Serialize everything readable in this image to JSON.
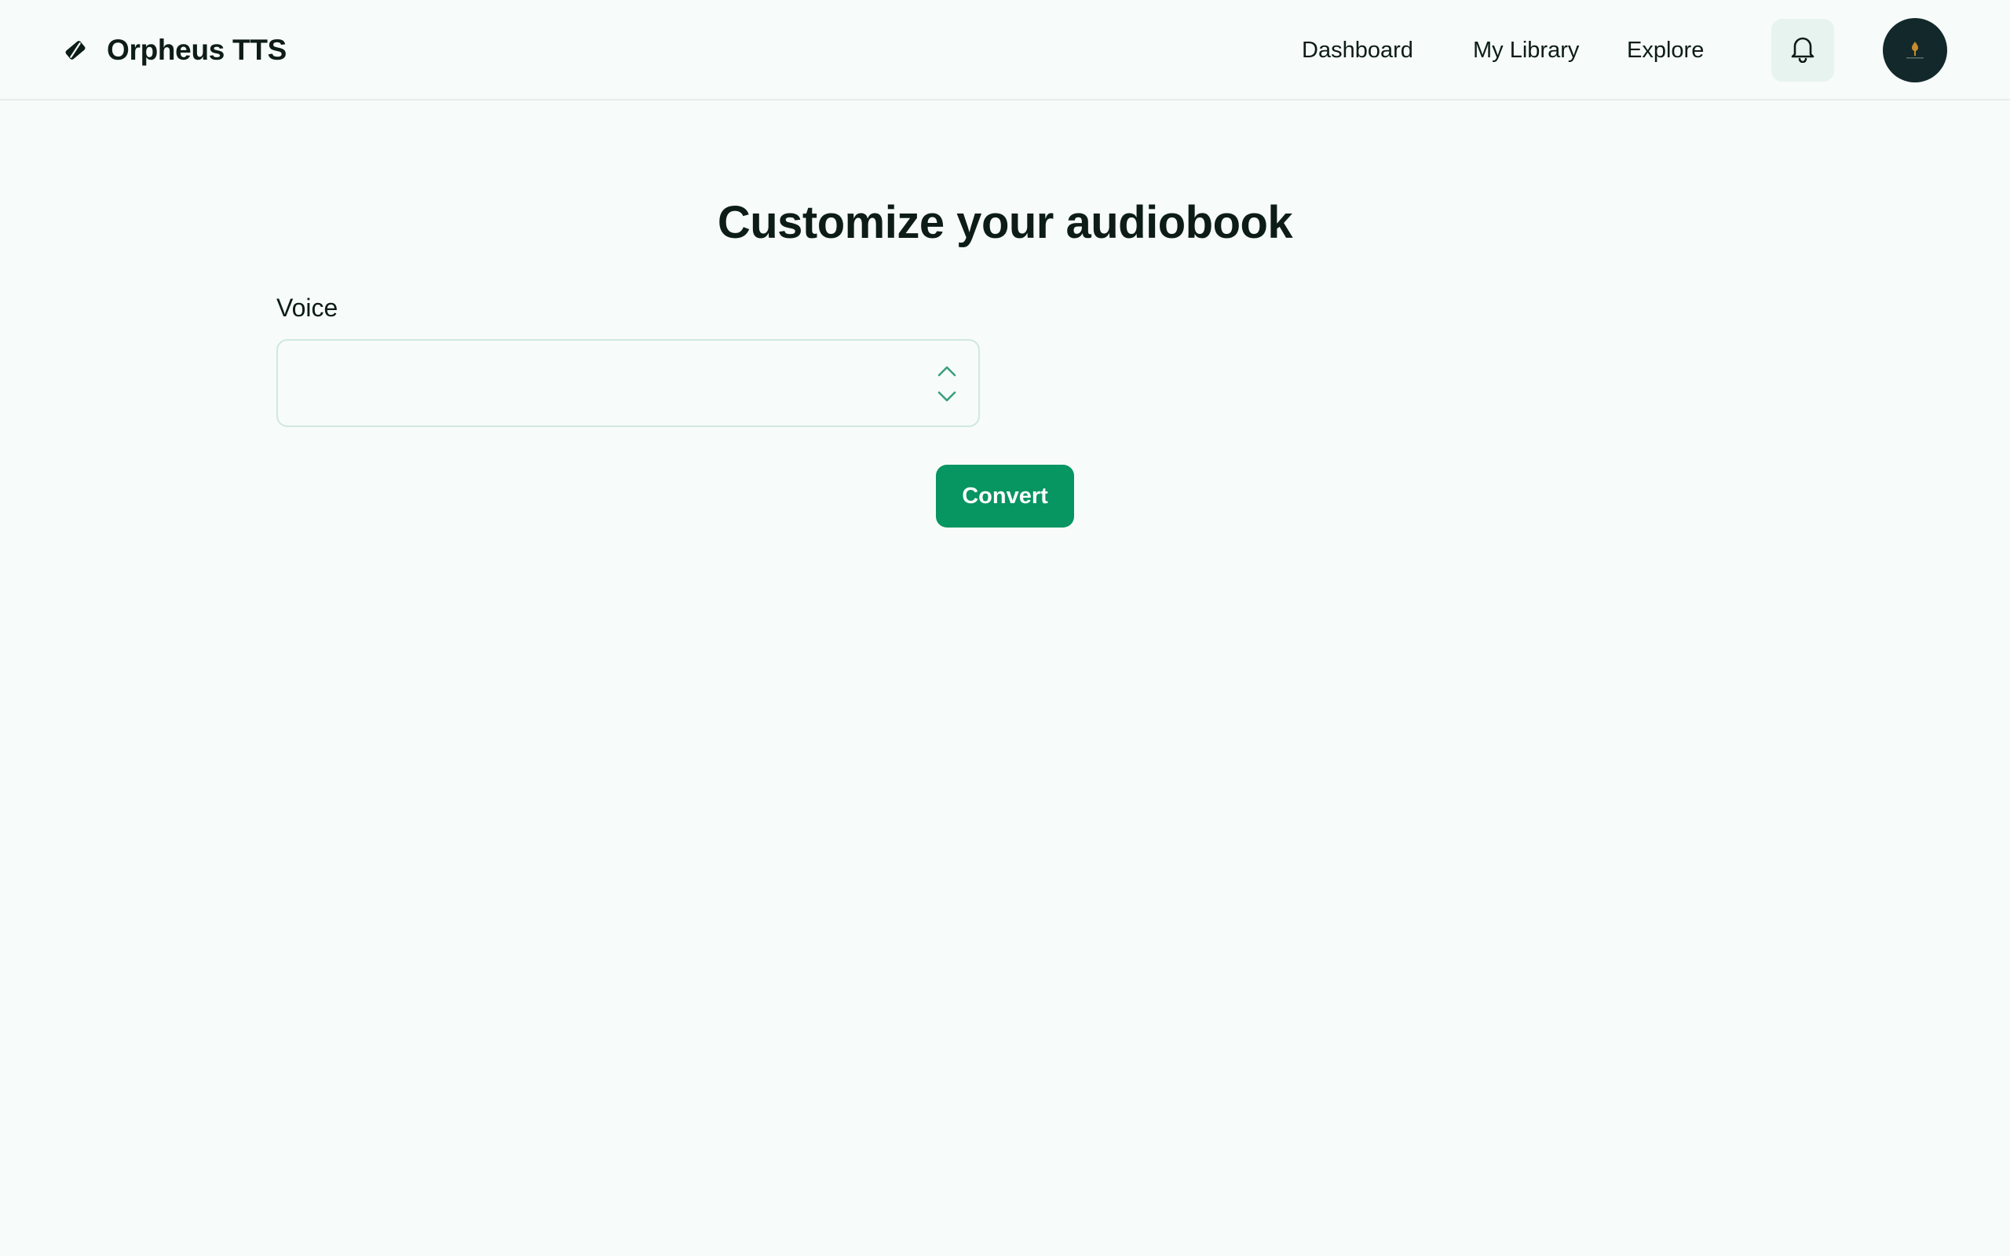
{
  "app": {
    "title": "Orpheus TTS",
    "logo_icon": "tag-diamond-icon"
  },
  "nav": {
    "items": [
      {
        "label": "Dashboard"
      },
      {
        "label": "My Library"
      },
      {
        "label": "Explore"
      }
    ],
    "notifications_icon": "bell-icon",
    "avatar_icon": "user-avatar"
  },
  "main": {
    "title": "Customize your audiobook",
    "voice": {
      "label": "Voice",
      "value": "",
      "icon": "chevron-up-down-icon"
    },
    "convert_label": "Convert"
  },
  "colors": {
    "background": "#f7fbfa",
    "accent": "#079561",
    "text": "#0d1c17",
    "bell_bg": "#e7f3ef",
    "avatar_bg": "#13282a",
    "select_border": "#cfe8df"
  }
}
